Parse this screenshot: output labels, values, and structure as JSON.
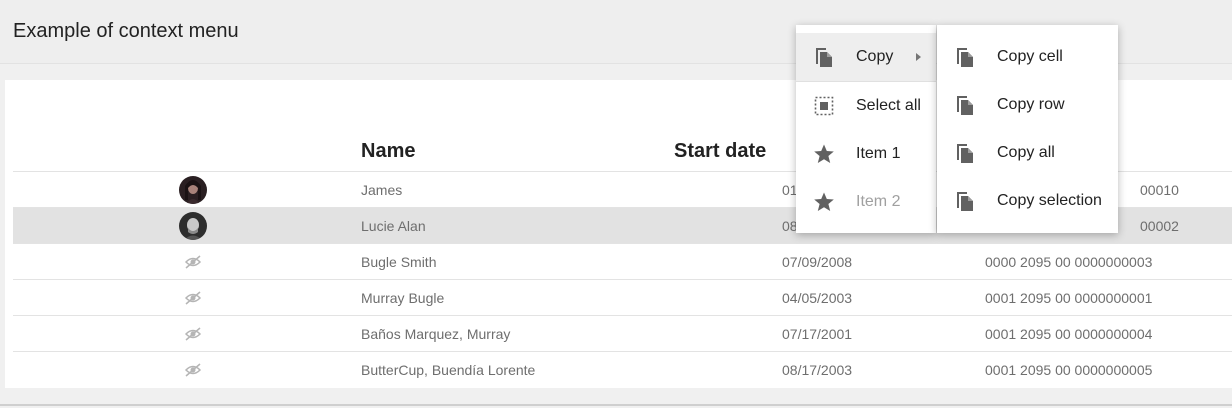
{
  "header": {
    "title": "Example of context menu"
  },
  "table": {
    "columns": {
      "name": "Name",
      "start": "Start date"
    },
    "rows": [
      {
        "avatar": "photo",
        "name": "James",
        "date": "01",
        "account": "00010"
      },
      {
        "avatar": "photo",
        "name": "Lucie Alan",
        "date": "08",
        "account": "00002",
        "selected": true
      },
      {
        "avatar": "no-image-icon",
        "name": "Bugle Smith",
        "date": "07/09/2008",
        "account": "0000 2095 00 0000000003"
      },
      {
        "avatar": "no-image-icon",
        "name": "Murray Bugle",
        "date": "04/05/2003",
        "account": "0001 2095 00 0000000001"
      },
      {
        "avatar": "no-image-icon",
        "name": "Baños Marquez, Murray",
        "date": "07/17/2001",
        "account": "0001 2095 00 0000000004"
      },
      {
        "avatar": "no-image-icon",
        "name": "ButterCup, Buendía Lorente",
        "date": "08/17/2003",
        "account": "0001 2095 00 0000000005"
      }
    ]
  },
  "context_menu": {
    "items": [
      {
        "label": "Copy",
        "icon": "copy-icon",
        "submenu": true,
        "highlighted": true
      },
      {
        "label": "Select all",
        "icon": "select-all-icon"
      },
      {
        "label": "Item 1",
        "icon": "star-icon"
      },
      {
        "label": "Item 2",
        "icon": "star-icon",
        "disabled": true
      }
    ],
    "submenu": [
      {
        "label": "Copy cell",
        "icon": "copy-icon"
      },
      {
        "label": "Copy row",
        "icon": "copy-icon"
      },
      {
        "label": "Copy all",
        "icon": "copy-icon"
      },
      {
        "label": "Copy selection",
        "icon": "copy-icon"
      }
    ]
  },
  "colors": {
    "icon": "#616161",
    "selected_row": "#e2e2e2",
    "menu_highlight": "#eeeeee",
    "disabled_text": "#a0a0a0"
  }
}
